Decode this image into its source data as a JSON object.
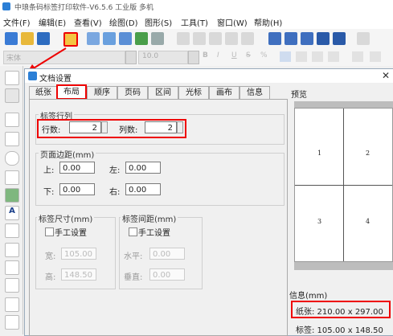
{
  "app": {
    "title": "中琅条码标签打印软件-V6.5.6 工业版 多机"
  },
  "menu": [
    "文件(F)",
    "编辑(E)",
    "查看(V)",
    "绘图(D)",
    "图形(S)",
    "工具(T)",
    "窗口(W)",
    "帮助(H)"
  ],
  "toolbar": {
    "font_value": "宋体",
    "size_value": "10.0",
    "format_buttons": [
      "B",
      "I",
      "U",
      "S",
      "%"
    ]
  },
  "dialog": {
    "title": "文档设置",
    "tabs": [
      "纸张",
      "布局",
      "顺序",
      "页码",
      "区间",
      "光标",
      "画布",
      "信息"
    ],
    "active_tab": "布局",
    "rows_cols": {
      "legend": "标签行列",
      "rows_label": "行数:",
      "rows_value": "2",
      "cols_label": "列数:",
      "cols_value": "2"
    },
    "margins": {
      "legend": "页面边距(mm)",
      "top_label": "上:",
      "top": "0.00",
      "left_label": "左:",
      "left": "0.00",
      "bottom_label": "下:",
      "bottom": "0.00",
      "right_label": "右:",
      "right": "0.00"
    },
    "label_size": {
      "legend": "标签尺寸(mm)",
      "manual": "手工设置",
      "width_label": "宽:",
      "width": "105.00",
      "height_label": "高:",
      "height": "148.50"
    },
    "label_gap": {
      "legend": "标签间距(mm)",
      "manual": "手工设置",
      "h_label": "水平:",
      "h": "0.00",
      "v_label": "垂直:",
      "v": "0.00"
    },
    "preview": {
      "legend": "预览",
      "cells": [
        "1",
        "2",
        "3",
        "4"
      ]
    },
    "info": {
      "legend": "信息(mm)",
      "paper": "纸张: 210.00 x 297.00",
      "label": "标签: 105.00 x 148.50"
    }
  },
  "colors": {
    "highlight": "#e00000",
    "accent": "#2b7fd6"
  }
}
